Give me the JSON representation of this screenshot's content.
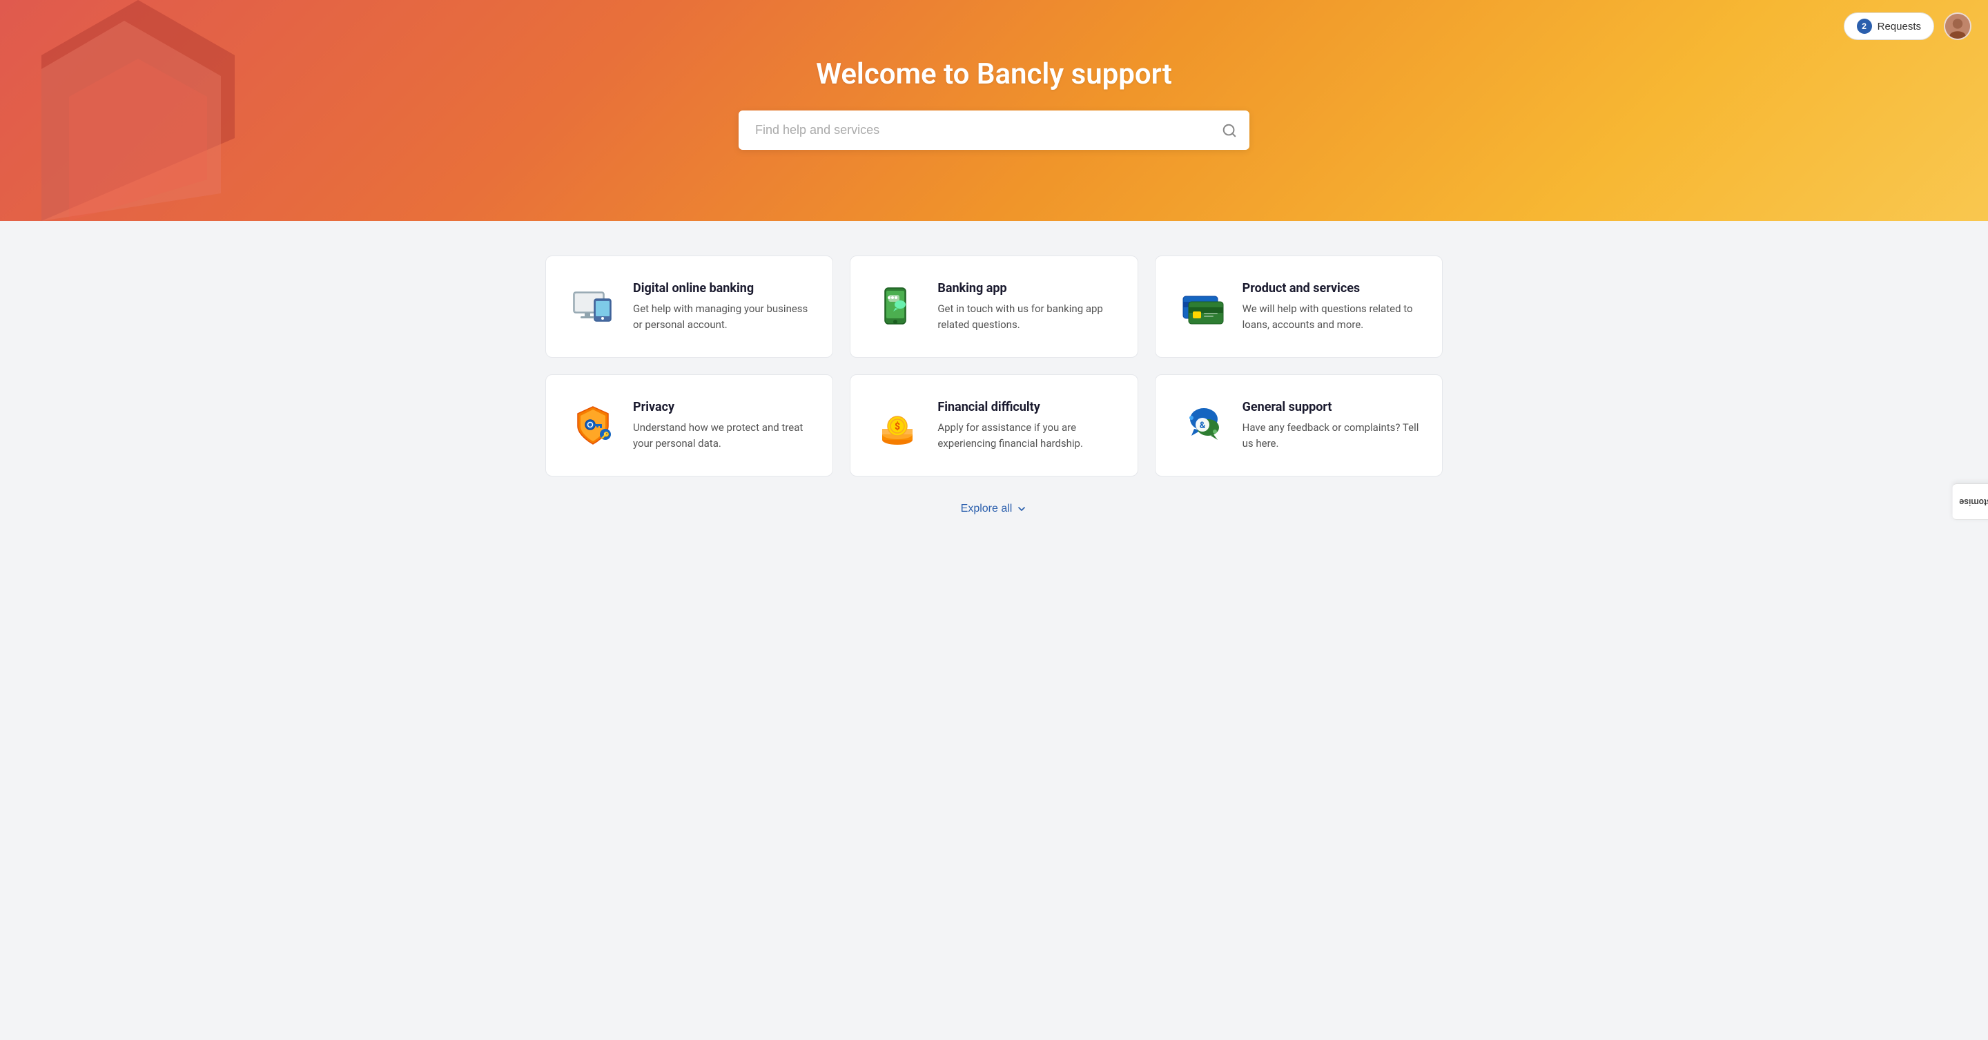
{
  "hero": {
    "title": "Welcome to Bancly support",
    "search_placeholder": "Find help and services"
  },
  "nav": {
    "requests_label": "Requests",
    "requests_count": "2",
    "customise_label": "Customise"
  },
  "cards": [
    {
      "id": "digital-banking",
      "title": "Digital online banking",
      "description": "Get help with managing your business or personal account.",
      "icon": "desktop"
    },
    {
      "id": "banking-app",
      "title": "Banking app",
      "description": "Get in touch with us for banking app related questions.",
      "icon": "mobile"
    },
    {
      "id": "product-services",
      "title": "Product and services",
      "description": "We will help with questions related to loans, accounts and more.",
      "icon": "card"
    },
    {
      "id": "privacy",
      "title": "Privacy",
      "description": "Understand how we protect and treat your personal data.",
      "icon": "shield"
    },
    {
      "id": "financial-difficulty",
      "title": "Financial difficulty",
      "description": "Apply for assistance if you are experiencing financial hardship.",
      "icon": "money"
    },
    {
      "id": "general-support",
      "title": "General support",
      "description": "Have any feedback or complaints? Tell us here.",
      "icon": "chat"
    }
  ],
  "explore_all_label": "Explore all"
}
